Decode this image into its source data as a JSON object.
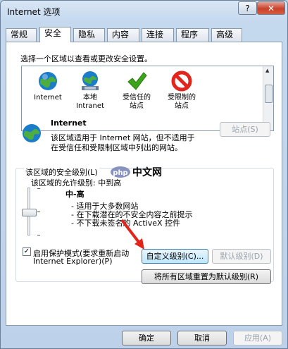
{
  "window": {
    "title": "Internet 选项",
    "help_label": "?",
    "close_label": "✕"
  },
  "tabs": [
    {
      "label": "常规"
    },
    {
      "label": "安全"
    },
    {
      "label": "隐私"
    },
    {
      "label": "内容"
    },
    {
      "label": "连接"
    },
    {
      "label": "程序"
    },
    {
      "label": "高级"
    }
  ],
  "active_tab": "安全",
  "security": {
    "instruction": "选择一个区域以查看或更改安全设置。",
    "zones": [
      {
        "line1": "Internet",
        "line2": "",
        "icon": "globe-icon"
      },
      {
        "line1": "本地",
        "line2": "Intranet",
        "icon": "intranet-globe-icon"
      },
      {
        "line1": "受信任的",
        "line2": "站点",
        "icon": "checkmark-icon"
      },
      {
        "line1": "受限制的",
        "line2": "站点",
        "icon": "restricted-icon"
      }
    ],
    "selected_zone": {
      "name": "Internet",
      "desc_line1": "该区域适用于 Internet 网站，但不适用于",
      "desc_line2": "在受信任和受限制区域中列出的网站。"
    },
    "sites_button": "站点(S)",
    "level_group_title": "该区域的安全级别(L)",
    "allowed_levels": "该区域的允许级别: 中到高",
    "level_name": "中-高",
    "level_bullets": [
      "- 适用于大多数网站",
      "- 在下载潜在的不安全内容之前提示",
      "- 不下载未签名的 ActiveX 控件"
    ],
    "protected_mode_label_line1": "启用保护模式(要求重新启动",
    "protected_mode_label_line2": "Internet Explorer)(P)",
    "protected_mode_checked": true,
    "custom_level_button": "自定义级别(C)...",
    "default_level_button": "默认级别(D)",
    "reset_all_button": "将所有区域重置为默认级别(R)"
  },
  "footer": {
    "ok": "确定",
    "cancel": "取消",
    "apply": "应用(A)"
  },
  "watermark": {
    "text": "中文网",
    "logo_text": "php"
  },
  "colors": {
    "accent_red": "#e2241b",
    "ok_green": "#3ea31c",
    "globe_blue": "#1b7cc9"
  }
}
